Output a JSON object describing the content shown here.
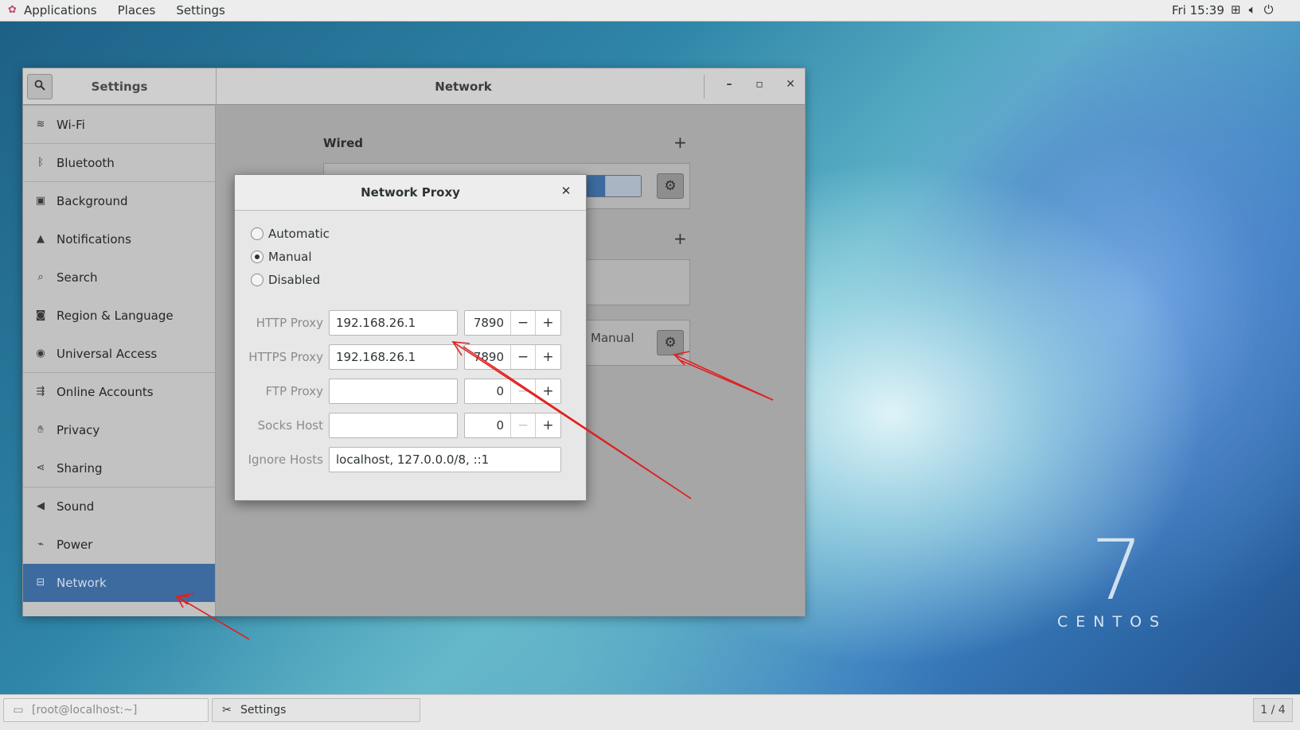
{
  "topbar": {
    "menus": [
      "Applications",
      "Places",
      "Settings"
    ],
    "clock": "Fri 15:39",
    "tray_icons": [
      "network-icon",
      "volume-icon",
      "power-icon"
    ]
  },
  "settings_window": {
    "sidebar_title": "Settings",
    "main_title": "Network",
    "sidebar_items": [
      {
        "label": "Wi-Fi",
        "icon": "wifi-icon"
      },
      {
        "label": "Bluetooth",
        "icon": "bluetooth-icon"
      },
      {
        "label": "Background",
        "icon": "background-icon"
      },
      {
        "label": "Notifications",
        "icon": "bell-icon"
      },
      {
        "label": "Search",
        "icon": "search-icon"
      },
      {
        "label": "Region & Language",
        "icon": "camera-icon"
      },
      {
        "label": "Universal Access",
        "icon": "accessibility-icon"
      },
      {
        "label": "Online Accounts",
        "icon": "online-accounts-icon"
      },
      {
        "label": "Privacy",
        "icon": "hand-icon"
      },
      {
        "label": "Sharing",
        "icon": "share-icon"
      },
      {
        "label": "Sound",
        "icon": "speaker-icon"
      },
      {
        "label": "Power",
        "icon": "power-plug-icon"
      },
      {
        "label": "Network",
        "icon": "network-icon"
      }
    ],
    "selected_item": "Network",
    "network": {
      "wired_label": "Wired",
      "proxy_mode": "Manual"
    }
  },
  "proxy_dialog": {
    "title": "Network Proxy",
    "options": [
      "Automatic",
      "Manual",
      "Disabled"
    ],
    "selected_option": "Manual",
    "rows": [
      {
        "label": "HTTP Proxy",
        "host": "192.168.26.1",
        "port": "7890"
      },
      {
        "label": "HTTPS Proxy",
        "host": "192.168.26.1",
        "port": "7890"
      },
      {
        "label": "FTP Proxy",
        "host": "",
        "port": "0"
      },
      {
        "label": "Socks Host",
        "host": "",
        "port": "0"
      }
    ],
    "ignore_label": "Ignore Hosts",
    "ignore_hosts": "localhost, 127.0.0.0/8, ::1"
  },
  "watermark": {
    "number": "7",
    "text": "CENTOS"
  },
  "taskbar": {
    "tasks": [
      "[root@localhost:~]",
      "Settings"
    ],
    "workspace": "1 / 4"
  },
  "colors": {
    "accent": "#3d6ba0",
    "annotation": "#e02020"
  }
}
